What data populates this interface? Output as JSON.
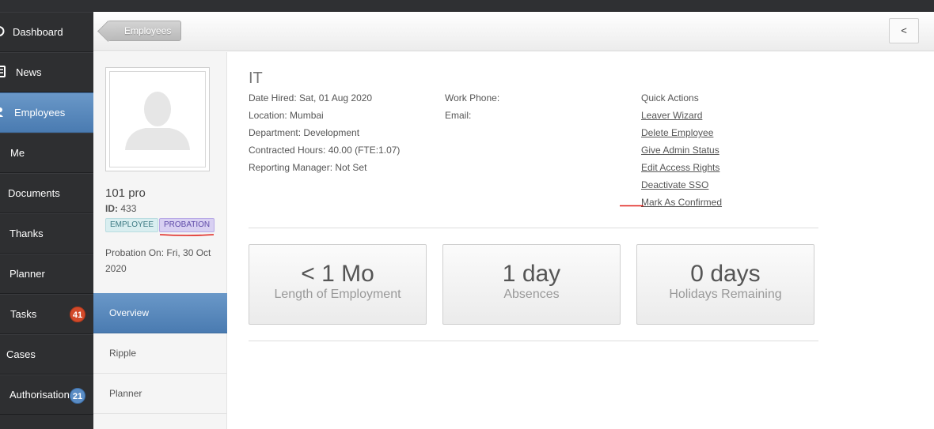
{
  "sidebar": {
    "items": [
      {
        "label": "Dashboard",
        "icon": "dashboard-icon"
      },
      {
        "label": "News",
        "icon": "news-icon"
      },
      {
        "label": "Employees",
        "icon": "person-icon",
        "active": true
      },
      {
        "label": "Me"
      },
      {
        "label": "Documents"
      },
      {
        "label": "Thanks"
      },
      {
        "label": "Planner"
      },
      {
        "label": "Tasks",
        "badge": "41"
      },
      {
        "label": "Cases"
      },
      {
        "label": "Authorisations",
        "badge": "21"
      }
    ]
  },
  "header": {
    "breadcrumb": "Employees",
    "collapse_label": "<"
  },
  "profile": {
    "name": "101 pro",
    "id_label": "ID:",
    "id_value": "433",
    "tags": [
      "EMPLOYEE",
      "PROBATION"
    ],
    "probation_on": "Probation On: Fri, 30 Oct 2020",
    "subnav": [
      "Overview",
      "Ripple",
      "Planner"
    ]
  },
  "main": {
    "department_title": "IT",
    "details": {
      "date_hired": "Date Hired: Sat, 01 Aug 2020",
      "location": "Location: Mumbai",
      "department": "Department: Development",
      "contracted_hours": "Contracted Hours: 40.00 (FTE:1.07)",
      "reporting_manager": "Reporting Manager: Not Set"
    },
    "contact": {
      "work_phone": "Work Phone:",
      "email": "Email:"
    },
    "quick_actions": {
      "heading": "Quick Actions",
      "links": [
        "Leaver Wizard",
        "Delete Employee",
        "Give Admin Status",
        "Edit Access Rights",
        "Deactivate SSO",
        "Mark As Confirmed"
      ]
    },
    "stats": [
      {
        "value": "< 1 Mo",
        "label": "Length of Employment"
      },
      {
        "value": "1 day",
        "label": "Absences"
      },
      {
        "value": "0 days",
        "label": "Holidays Remaining"
      }
    ]
  },
  "colors": {
    "sidebar_bg": "#2e2f31",
    "active_blue": "#5a8ac0",
    "annotation_red": "#e0201a",
    "badge_red": "#d24a2a",
    "badge_blue": "#5a8cc4"
  }
}
